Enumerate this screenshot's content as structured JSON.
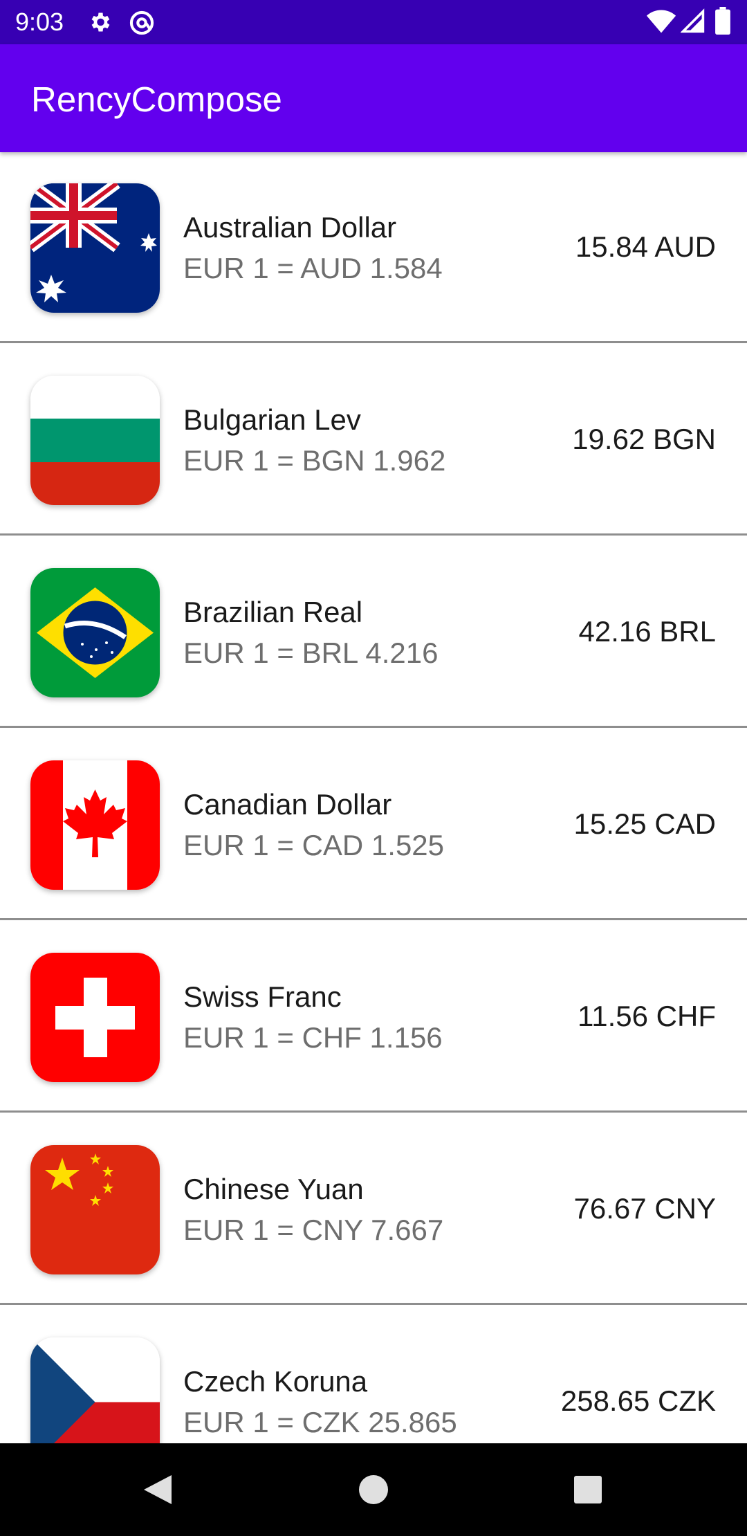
{
  "status_bar": {
    "time": "9:03",
    "left_icons": [
      "gear-icon",
      "at-sign-icon"
    ],
    "right_icons": [
      "wifi-icon",
      "cell-signal-icon",
      "battery-icon"
    ]
  },
  "app_bar": {
    "title": "RencyCompose",
    "background_color": "#6200ee",
    "status_color": "#3700b3"
  },
  "currencies": [
    {
      "name": "Australian Dollar",
      "rate": "EUR 1 = AUD 1.584",
      "amount": "15.84 AUD",
      "flag": "australia-flag-icon"
    },
    {
      "name": "Bulgarian Lev",
      "rate": "EUR 1 = BGN 1.962",
      "amount": "19.62 BGN",
      "flag": "bulgaria-flag-icon"
    },
    {
      "name": "Brazilian Real",
      "rate": "EUR 1 = BRL 4.216",
      "amount": "42.16 BRL",
      "flag": "brazil-flag-icon"
    },
    {
      "name": "Canadian Dollar",
      "rate": "EUR 1 = CAD 1.525",
      "amount": "15.25 CAD",
      "flag": "canada-flag-icon"
    },
    {
      "name": "Swiss Franc",
      "rate": "EUR 1 = CHF 1.156",
      "amount": "11.56 CHF",
      "flag": "switzerland-flag-icon"
    },
    {
      "name": "Chinese Yuan",
      "rate": "EUR 1 = CNY 7.667",
      "amount": "76.67 CNY",
      "flag": "china-flag-icon"
    },
    {
      "name": "Czech Koruna",
      "rate": "EUR 1 = CZK 25.865",
      "amount": "258.65 CZK",
      "flag": "czech-flag-icon"
    }
  ],
  "nav_bar": {
    "buttons": [
      "back-icon",
      "home-icon",
      "recents-icon"
    ]
  }
}
